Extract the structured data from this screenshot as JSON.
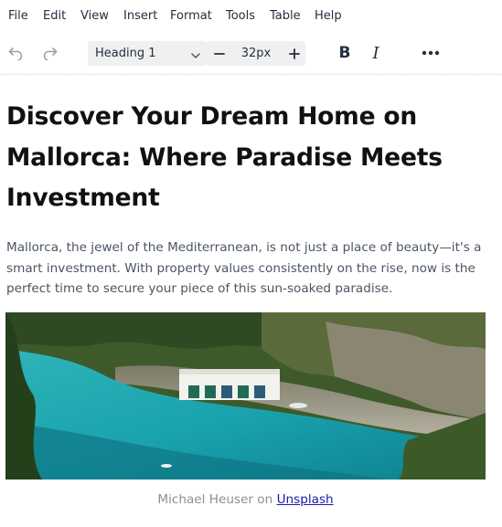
{
  "menubar": {
    "items": [
      "File",
      "Edit",
      "View",
      "Insert",
      "Format",
      "Tools",
      "Table",
      "Help"
    ]
  },
  "toolbar": {
    "undo_icon": "undo-icon",
    "redo_icon": "redo-icon",
    "block_format": "Heading 1",
    "font_size": "32px",
    "bold_label": "B",
    "italic_label": "I",
    "more_icon": "more-icon"
  },
  "document": {
    "title": "Discover Your Dream Home on Mallorca: Where Paradise Meets Investment",
    "intro": "Mallorca, the jewel of the Mediterranean, is not just a place of beauty—it's a smart investment. With property values consistently on the rise, now is the perfect time to secure your piece of this sun-soaked paradise.",
    "caption_author": "Michael Heuser",
    "caption_on": "on",
    "caption_link": "Unsplash"
  },
  "colors": {
    "text": "#222f3e",
    "heading": "#111111",
    "body_text": "#4a5563",
    "caption": "#8a8f96",
    "link": "#1a1aa6",
    "toolbar_group_bg": "#f0f0f0"
  }
}
